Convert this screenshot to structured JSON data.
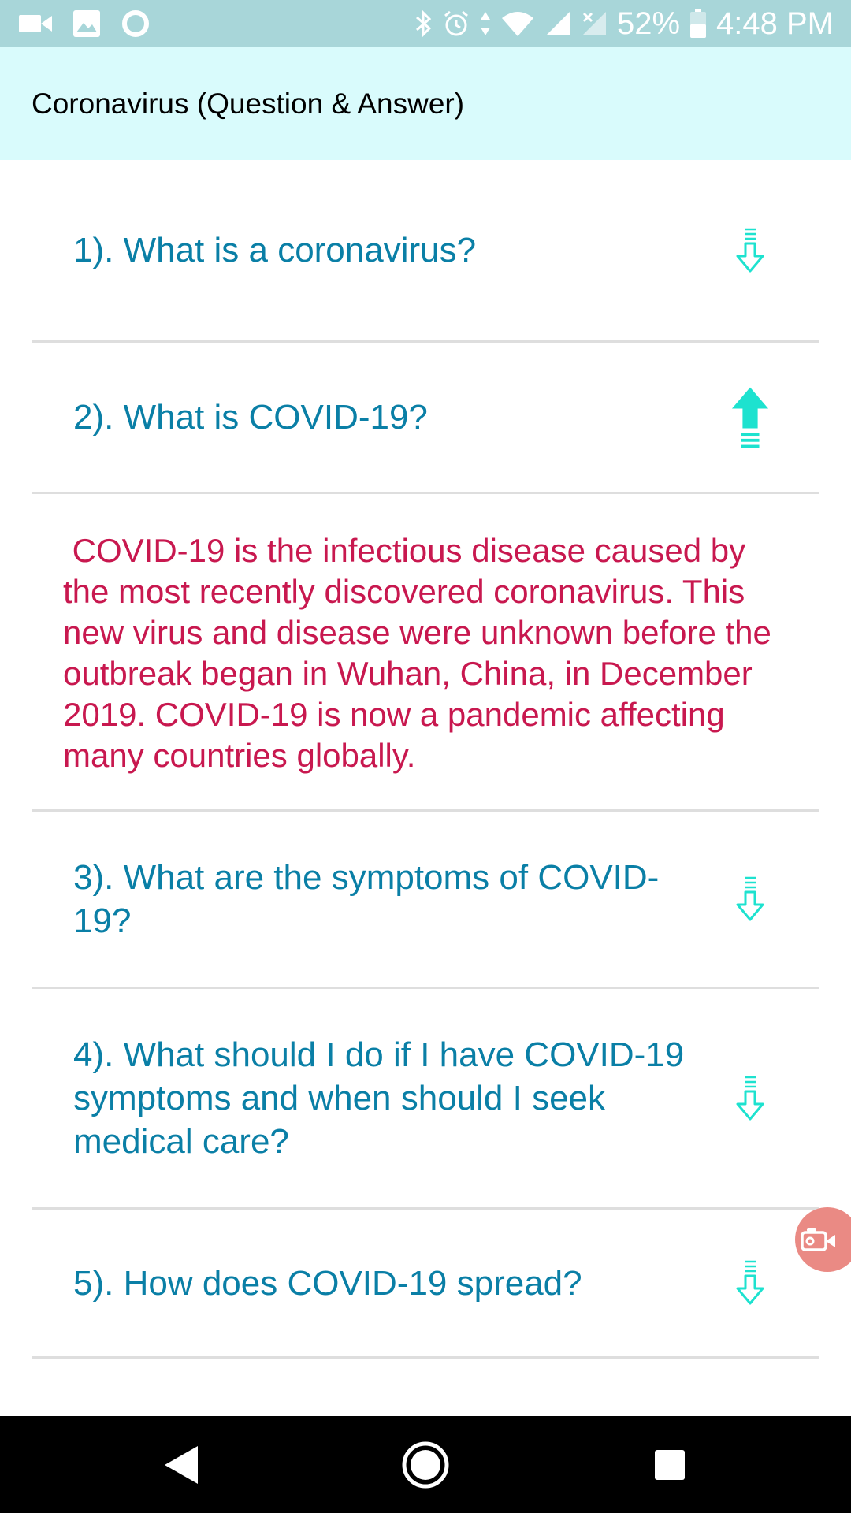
{
  "status_bar": {
    "left_icons": [
      "video-camera-icon",
      "image-icon",
      "circle-ring-icon"
    ],
    "right_icons": [
      "bluetooth-icon",
      "alarm-icon",
      "data-arrows-icon",
      "wifi-icon",
      "signal-icon",
      "signal-no-sim-icon",
      "battery-icon"
    ],
    "battery_percent": "52%",
    "battery_level": 0.52,
    "time": "4:48 PM"
  },
  "app_bar": {
    "title": "Coronavirus (Question & Answer)"
  },
  "faq": {
    "items": [
      {
        "question": "1). What is a coronavirus?",
        "expanded": false,
        "toggle_icon": "arrow-down-outline-icon"
      },
      {
        "question": "2). What is COVID-19?",
        "expanded": true,
        "toggle_icon": "arrow-up-filled-icon",
        "answer": " COVID-19 is the infectious disease caused by the most recently discovered coronavirus. This new virus and disease were unknown before the outbreak began in Wuhan, China, in December 2019. COVID-19 is now a pandemic affecting many countries globally."
      },
      {
        "question": "3). What are the symptoms of COVID-19?",
        "expanded": false,
        "toggle_icon": "arrow-down-outline-icon"
      },
      {
        "question": "4). What should I do if I have COVID-19 symptoms and when should I seek medical care?",
        "expanded": false,
        "toggle_icon": "arrow-down-outline-icon"
      },
      {
        "question": "5). How does COVID-19 spread?",
        "expanded": false,
        "toggle_icon": "arrow-down-outline-icon"
      }
    ]
  },
  "fab": {
    "icon": "video-camera-icon"
  },
  "nav_bar": {
    "icons": [
      "back-icon",
      "home-icon",
      "recents-icon"
    ]
  },
  "colors": {
    "status_bar_bg": "#a8d6d9",
    "app_bar_bg": "#d9fbfc",
    "question_text": "#0a7fa6",
    "answer_text": "#c8184f",
    "arrow_accent": "#1de2cf",
    "divider": "#dedede",
    "fab_bg": "#ea8a84"
  }
}
